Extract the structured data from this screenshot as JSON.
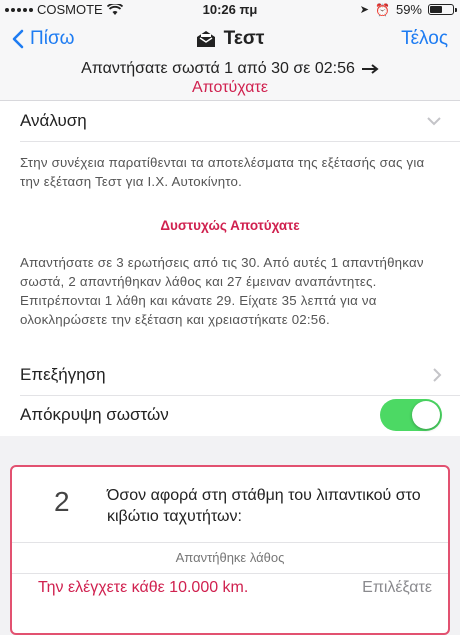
{
  "status_bar": {
    "carrier": "COSMOTE",
    "time": "10:26 πμ",
    "battery_percent": "59%",
    "battery_level": 0.59
  },
  "nav": {
    "back_label": "Πίσω",
    "title": "Τεστ",
    "title_icon": "envelope-open-icon",
    "done_label": "Τέλος"
  },
  "summary": {
    "score_text": "Απαντήσατε σωστά 1 από 30 σε 02:56",
    "result": "Αποτύχατε"
  },
  "analysis": {
    "header": "Ανάλυση",
    "intro": "Στην συνέχεια παρατίθενται τα αποτελέσματα της εξέτασής σας για την εξέταση Τεστ για Ι.Χ. Αυτοκίνητο.",
    "fail_heading": "Δυστυχώς Αποτύχατε",
    "details": "Απαντήσατε σε 3 ερωτήσεις από τις 30. Από αυτές 1 απαντήθηκαν σωστά, 2 απαντήθηκαν λάθος και 27 έμειναν αναπάντητες. Επιτρέπονται 1 λάθη και κάνατε 29. Είχατε 35 λεπτά για να ολοκληρώσετε την εξέταση και χρειαστήκατε 02:56.",
    "explanation_label": "Επεξήγηση",
    "hide_correct_label": "Απόκρυψη σωστών",
    "hide_correct_on": true
  },
  "question": {
    "number": "2",
    "text": "Όσον αφορά στη στάθμη του λιπαντικού στο κιβώτιο ταχυτήτων:",
    "status": "Απαντήθηκε λάθος",
    "answer": "Την ελέγχετε κάθε 10.000 km.",
    "choice_label": "Επιλέξατε"
  },
  "colors": {
    "accent_blue": "#1e7cf2",
    "fail_red": "#d0214f",
    "toggle_green": "#4cd964"
  }
}
